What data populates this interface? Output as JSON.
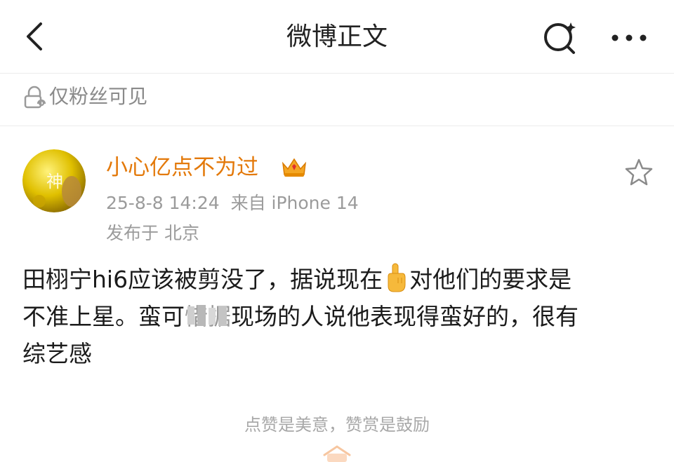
{
  "header": {
    "title": "微博正文",
    "back_icon": "chevron-left-icon",
    "search_icon": "search-icon",
    "more_icon": "more-dots-icon"
  },
  "visibility": {
    "icon": "lock-icon",
    "text": "仅粉丝可见"
  },
  "author": {
    "avatar_char": "神",
    "name": "小心亿点不为过",
    "badge_icon": "crown-icon",
    "time": "25-8-8 14:24",
    "source": "来自 iPhone 14",
    "location": "发布于 北京"
  },
  "post": {
    "line1_a": "田栩宁hi6应该被剪没了，据说现在",
    "emoji_icon": "pointing-up-hand-icon",
    "line1_b": "对他们的要求是",
    "line2_a": "不准上星。蛮可",
    "line2_blur": "惜",
    "line2_b": "据现场的人说他表现得蛮好的，很有",
    "line3": "综艺感"
  },
  "footer": {
    "tip": "点赞是美意，赞赏是鼓励",
    "reward_icon": "reward-icon"
  },
  "colors": {
    "accent": "#e3790a",
    "meta_gray": "#9b9b9b",
    "divider": "#ececec",
    "avatar_gold": "#d9b400"
  }
}
